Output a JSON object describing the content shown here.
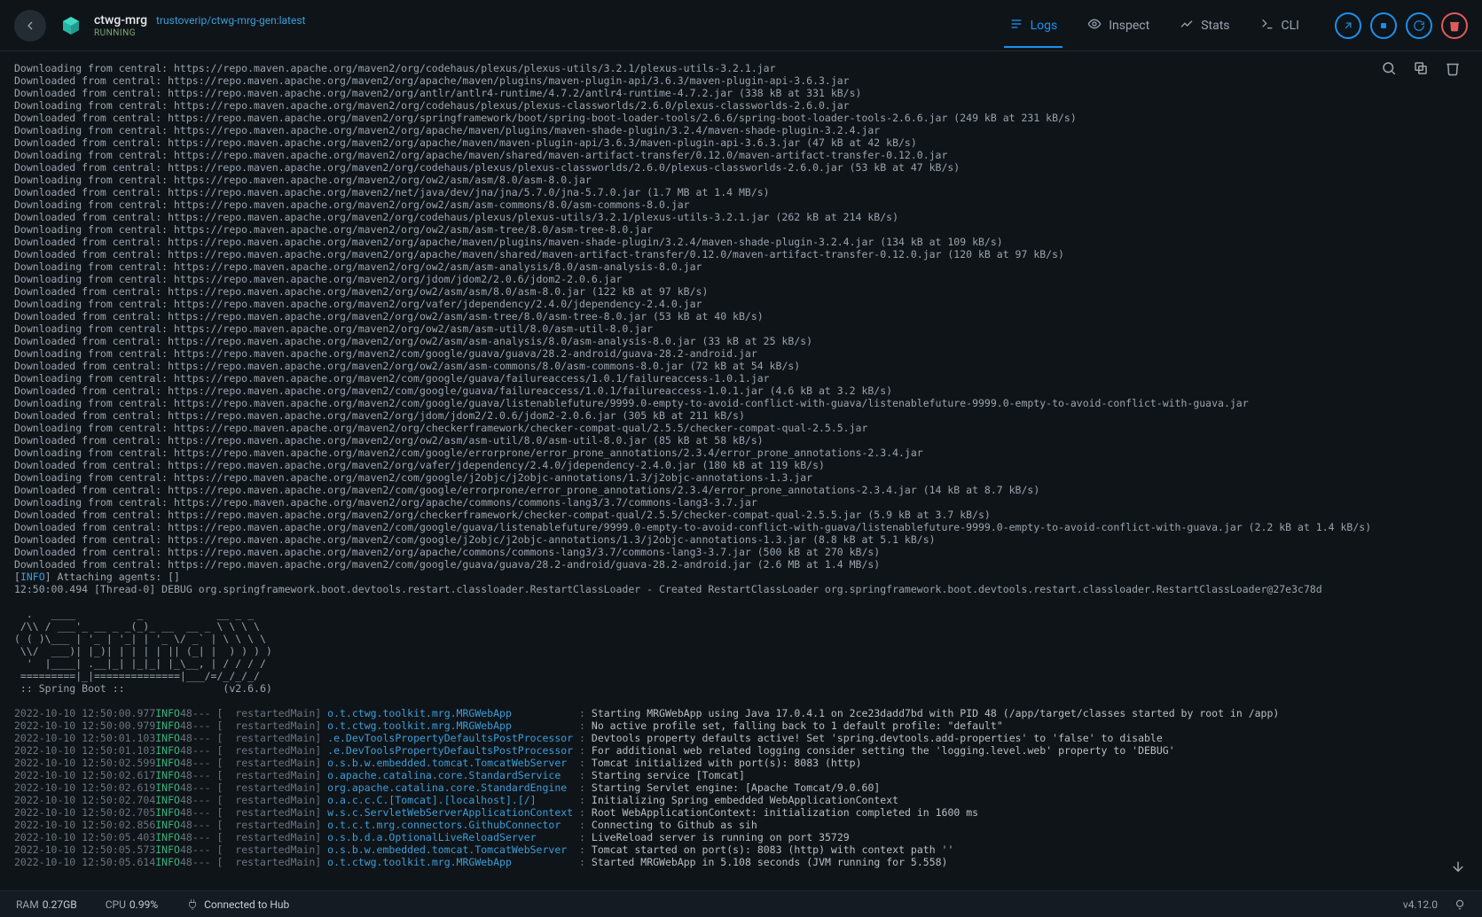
{
  "header": {
    "name": "ctwg-mrg",
    "image": "trustoverip/ctwg-mrg-gen:latest",
    "status": "RUNNING"
  },
  "tabs": [
    {
      "id": "logs",
      "label": "Logs",
      "active": true
    },
    {
      "id": "inspect",
      "label": "Inspect",
      "active": false
    },
    {
      "id": "stats",
      "label": "Stats",
      "active": false
    },
    {
      "id": "cli",
      "label": "CLI",
      "active": false
    }
  ],
  "circle_actions": [
    "open-browser",
    "stop",
    "restart",
    "delete"
  ],
  "log_tools": [
    "search",
    "copy",
    "delete"
  ],
  "maven_lines": [
    "Downloading from central: https://repo.maven.apache.org/maven2/org/codehaus/plexus/plexus-utils/3.2.1/plexus-utils-3.2.1.jar",
    "Downloaded from central: https://repo.maven.apache.org/maven2/org/apache/maven/plugins/maven-plugin-api/3.6.3/maven-plugin-api-3.6.3.jar",
    "Downloaded from central: https://repo.maven.apache.org/maven2/org/antlr/antlr4-runtime/4.7.2/antlr4-runtime-4.7.2.jar (338 kB at 331 kB/s)",
    "Downloading from central: https://repo.maven.apache.org/maven2/org/codehaus/plexus/plexus-classworlds/2.6.0/plexus-classworlds-2.6.0.jar",
    "Downloaded from central: https://repo.maven.apache.org/maven2/org/springframework/boot/spring-boot-loader-tools/2.6.6/spring-boot-loader-tools-2.6.6.jar (249 kB at 231 kB/s)",
    "Downloading from central: https://repo.maven.apache.org/maven2/org/apache/maven/plugins/maven-shade-plugin/3.2.4/maven-shade-plugin-3.2.4.jar",
    "Downloaded from central: https://repo.maven.apache.org/maven2/org/apache/maven/maven-plugin-api/3.6.3/maven-plugin-api-3.6.3.jar (47 kB at 42 kB/s)",
    "Downloading from central: https://repo.maven.apache.org/maven2/org/apache/maven/shared/maven-artifact-transfer/0.12.0/maven-artifact-transfer-0.12.0.jar",
    "Downloaded from central: https://repo.maven.apache.org/maven2/org/codehaus/plexus/plexus-classworlds/2.6.0/plexus-classworlds-2.6.0.jar (53 kB at 47 kB/s)",
    "Downloading from central: https://repo.maven.apache.org/maven2/org/ow2/asm/asm/8.0/asm-8.0.jar",
    "Downloaded from central: https://repo.maven.apache.org/maven2/net/java/dev/jna/jna/5.7.0/jna-5.7.0.jar (1.7 MB at 1.4 MB/s)",
    "Downloading from central: https://repo.maven.apache.org/maven2/org/ow2/asm/asm-commons/8.0/asm-commons-8.0.jar",
    "Downloaded from central: https://repo.maven.apache.org/maven2/org/codehaus/plexus/plexus-utils/3.2.1/plexus-utils-3.2.1.jar (262 kB at 214 kB/s)",
    "Downloading from central: https://repo.maven.apache.org/maven2/org/ow2/asm/asm-tree/8.0/asm-tree-8.0.jar",
    "Downloaded from central: https://repo.maven.apache.org/maven2/org/apache/maven/plugins/maven-shade-plugin/3.2.4/maven-shade-plugin-3.2.4.jar (134 kB at 109 kB/s)",
    "Downloaded from central: https://repo.maven.apache.org/maven2/org/apache/maven/shared/maven-artifact-transfer/0.12.0/maven-artifact-transfer-0.12.0.jar (120 kB at 97 kB/s)",
    "Downloading from central: https://repo.maven.apache.org/maven2/org/ow2/asm/asm-analysis/8.0/asm-analysis-8.0.jar",
    "Downloading from central: https://repo.maven.apache.org/maven2/org/jdom/jdom2/2.0.6/jdom2-2.0.6.jar",
    "Downloaded from central: https://repo.maven.apache.org/maven2/org/ow2/asm/asm/8.0/asm-8.0.jar (122 kB at 97 kB/s)",
    "Downloading from central: https://repo.maven.apache.org/maven2/org/vafer/jdependency/2.4.0/jdependency-2.4.0.jar",
    "Downloaded from central: https://repo.maven.apache.org/maven2/org/ow2/asm/asm-tree/8.0/asm-tree-8.0.jar (53 kB at 40 kB/s)",
    "Downloading from central: https://repo.maven.apache.org/maven2/org/ow2/asm/asm-util/8.0/asm-util-8.0.jar",
    "Downloaded from central: https://repo.maven.apache.org/maven2/org/ow2/asm/asm-analysis/8.0/asm-analysis-8.0.jar (33 kB at 25 kB/s)",
    "Downloading from central: https://repo.maven.apache.org/maven2/com/google/guava/guava/28.2-android/guava-28.2-android.jar",
    "Downloaded from central: https://repo.maven.apache.org/maven2/org/ow2/asm/asm-commons/8.0/asm-commons-8.0.jar (72 kB at 54 kB/s)",
    "Downloading from central: https://repo.maven.apache.org/maven2/com/google/guava/failureaccess/1.0.1/failureaccess-1.0.1.jar",
    "Downloaded from central: https://repo.maven.apache.org/maven2/com/google/guava/failureaccess/1.0.1/failureaccess-1.0.1.jar (4.6 kB at 3.2 kB/s)",
    "Downloading from central: https://repo.maven.apache.org/maven2/com/google/guava/listenablefuture/9999.0-empty-to-avoid-conflict-with-guava/listenablefuture-9999.0-empty-to-avoid-conflict-with-guava.jar",
    "Downloaded from central: https://repo.maven.apache.org/maven2/org/jdom/jdom2/2.0.6/jdom2-2.0.6.jar (305 kB at 211 kB/s)",
    "Downloading from central: https://repo.maven.apache.org/maven2/org/checkerframework/checker-compat-qual/2.5.5/checker-compat-qual-2.5.5.jar",
    "Downloaded from central: https://repo.maven.apache.org/maven2/org/ow2/asm/asm-util/8.0/asm-util-8.0.jar (85 kB at 58 kB/s)",
    "Downloading from central: https://repo.maven.apache.org/maven2/com/google/errorprone/error_prone_annotations/2.3.4/error_prone_annotations-2.3.4.jar",
    "Downloaded from central: https://repo.maven.apache.org/maven2/org/vafer/jdependency/2.4.0/jdependency-2.4.0.jar (180 kB at 119 kB/s)",
    "Downloading from central: https://repo.maven.apache.org/maven2/com/google/j2objc/j2objc-annotations/1.3/j2objc-annotations-1.3.jar",
    "Downloaded from central: https://repo.maven.apache.org/maven2/com/google/errorprone/error_prone_annotations/2.3.4/error_prone_annotations-2.3.4.jar (14 kB at 8.7 kB/s)",
    "Downloading from central: https://repo.maven.apache.org/maven2/org/apache/commons/commons-lang3/3.7/commons-lang3-3.7.jar",
    "Downloaded from central: https://repo.maven.apache.org/maven2/org/checkerframework/checker-compat-qual/2.5.5/checker-compat-qual-2.5.5.jar (5.9 kB at 3.7 kB/s)",
    "Downloaded from central: https://repo.maven.apache.org/maven2/com/google/guava/listenablefuture/9999.0-empty-to-avoid-conflict-with-guava/listenablefuture-9999.0-empty-to-avoid-conflict-with-guava.jar (2.2 kB at 1.4 kB/s)",
    "Downloaded from central: https://repo.maven.apache.org/maven2/com/google/j2objc/j2objc-annotations/1.3/j2objc-annotations-1.3.jar (8.8 kB at 5.1 kB/s)",
    "Downloaded from central: https://repo.maven.apache.org/maven2/org/apache/commons/commons-lang3/3.7/commons-lang3-3.7.jar (500 kB at 270 kB/s)",
    "Downloaded from central: https://repo.maven.apache.org/maven2/com/google/guava/guava/28.2-android/guava-28.2-android.jar (2.6 MB at 1.4 MB/s)"
  ],
  "attach_line": {
    "prefix": "[",
    "tag": "INFO",
    "suffix": "] Attaching agents: []"
  },
  "debug_line": "12:50:00.494 [Thread-0] DEBUG org.springframework.boot.devtools.restart.classloader.RestartClassLoader - Created RestartClassLoader org.springframework.boot.devtools.restart.classloader.RestartClassLoader@27e3c78d",
  "banner": "  .   ____          _            __ _ _\n /\\\\ / ___'_ __ _ _(_)_ __  __ _ \\ \\ \\ \\\n( ( )\\___ | '_ | '_| | '_ \\/ _` | \\ \\ \\ \\\n \\\\/  ___)| |_)| | | | | || (_| |  ) ) ) )\n  '  |____| .__|_| |_|_| |_\\__, | / / / /\n =========|_|==============|___/=/_/_/_/\n :: Spring Boot ::                (v2.6.6)",
  "spring_lines": [
    {
      "ts": "2022-10-10 12:50:00.977",
      "lv": "INFO",
      "pid": "48",
      "sep": "--- [",
      "th": "  restartedMain",
      "sep2": "] ",
      "lg": "o.t.ctwg.toolkit.mrg.MRGWebApp          ",
      "colon": " : ",
      "msg": "Starting MRGWebApp using Java 17.0.4.1 on 2ce23dadd7bd with PID 48 (/app/target/classes started by root in /app)"
    },
    {
      "ts": "2022-10-10 12:50:00.979",
      "lv": "INFO",
      "pid": "48",
      "sep": "--- [",
      "th": "  restartedMain",
      "sep2": "] ",
      "lg": "o.t.ctwg.toolkit.mrg.MRGWebApp          ",
      "colon": " : ",
      "msg": "No active profile set, falling back to 1 default profile: \"default\""
    },
    {
      "ts": "2022-10-10 12:50:01.103",
      "lv": "INFO",
      "pid": "48",
      "sep": "--- [",
      "th": "  restartedMain",
      "sep2": "] ",
      "lg": ".e.DevToolsPropertyDefaultsPostProcessor",
      "colon": " : ",
      "msg": "Devtools property defaults active! Set 'spring.devtools.add-properties' to 'false' to disable"
    },
    {
      "ts": "2022-10-10 12:50:01.103",
      "lv": "INFO",
      "pid": "48",
      "sep": "--- [",
      "th": "  restartedMain",
      "sep2": "] ",
      "lg": ".e.DevToolsPropertyDefaultsPostProcessor",
      "colon": " : ",
      "msg": "For additional web related logging consider setting the 'logging.level.web' property to 'DEBUG'"
    },
    {
      "ts": "2022-10-10 12:50:02.599",
      "lv": "INFO",
      "pid": "48",
      "sep": "--- [",
      "th": "  restartedMain",
      "sep2": "] ",
      "lg": "o.s.b.w.embedded.tomcat.TomcatWebServer ",
      "colon": " : ",
      "msg": "Tomcat initialized with port(s): 8083 (http)"
    },
    {
      "ts": "2022-10-10 12:50:02.617",
      "lv": "INFO",
      "pid": "48",
      "sep": "--- [",
      "th": "  restartedMain",
      "sep2": "] ",
      "lg": "o.apache.catalina.core.StandardService  ",
      "colon": " : ",
      "msg": "Starting service [Tomcat]"
    },
    {
      "ts": "2022-10-10 12:50:02.619",
      "lv": "INFO",
      "pid": "48",
      "sep": "--- [",
      "th": "  restartedMain",
      "sep2": "] ",
      "lg": "org.apache.catalina.core.StandardEngine ",
      "colon": " : ",
      "msg": "Starting Servlet engine: [Apache Tomcat/9.0.60]"
    },
    {
      "ts": "2022-10-10 12:50:02.704",
      "lv": "INFO",
      "pid": "48",
      "sep": "--- [",
      "th": "  restartedMain",
      "sep2": "] ",
      "lg": "o.a.c.c.C.[Tomcat].[localhost].[/]      ",
      "colon": " : ",
      "msg": "Initializing Spring embedded WebApplicationContext"
    },
    {
      "ts": "2022-10-10 12:50:02.705",
      "lv": "INFO",
      "pid": "48",
      "sep": "--- [",
      "th": "  restartedMain",
      "sep2": "] ",
      "lg": "w.s.c.ServletWebServerApplicationContext",
      "colon": " : ",
      "msg": "Root WebApplicationContext: initialization completed in 1600 ms"
    },
    {
      "ts": "2022-10-10 12:50:02.856",
      "lv": "INFO",
      "pid": "48",
      "sep": "--- [",
      "th": "  restartedMain",
      "sep2": "] ",
      "lg": "o.t.c.t.mrg.connectors.GithubConnector  ",
      "colon": " : ",
      "msg": "Connecting to Github as sih"
    },
    {
      "ts": "2022-10-10 12:50:05.403",
      "lv": "INFO",
      "pid": "48",
      "sep": "--- [",
      "th": "  restartedMain",
      "sep2": "] ",
      "lg": "o.s.b.d.a.OptionalLiveReloadServer      ",
      "colon": " : ",
      "msg": "LiveReload server is running on port 35729"
    },
    {
      "ts": "2022-10-10 12:50:05.573",
      "lv": "INFO",
      "pid": "48",
      "sep": "--- [",
      "th": "  restartedMain",
      "sep2": "] ",
      "lg": "o.s.b.w.embedded.tomcat.TomcatWebServer ",
      "colon": " : ",
      "msg": "Tomcat started on port(s): 8083 (http) with context path ''"
    },
    {
      "ts": "2022-10-10 12:50:05.614",
      "lv": "INFO",
      "pid": "48",
      "sep": "--- [",
      "th": "  restartedMain",
      "sep2": "] ",
      "lg": "o.t.ctwg.toolkit.mrg.MRGWebApp          ",
      "colon": " : ",
      "msg": "Started MRGWebApp in 5.108 seconds (JVM running for 5.558)"
    }
  ],
  "footer": {
    "ram_label": "RAM",
    "ram_value": "0.27GB",
    "cpu_label": "CPU",
    "cpu_value": "0.99%",
    "hub": "Connected to Hub",
    "version": "v4.12.0"
  }
}
